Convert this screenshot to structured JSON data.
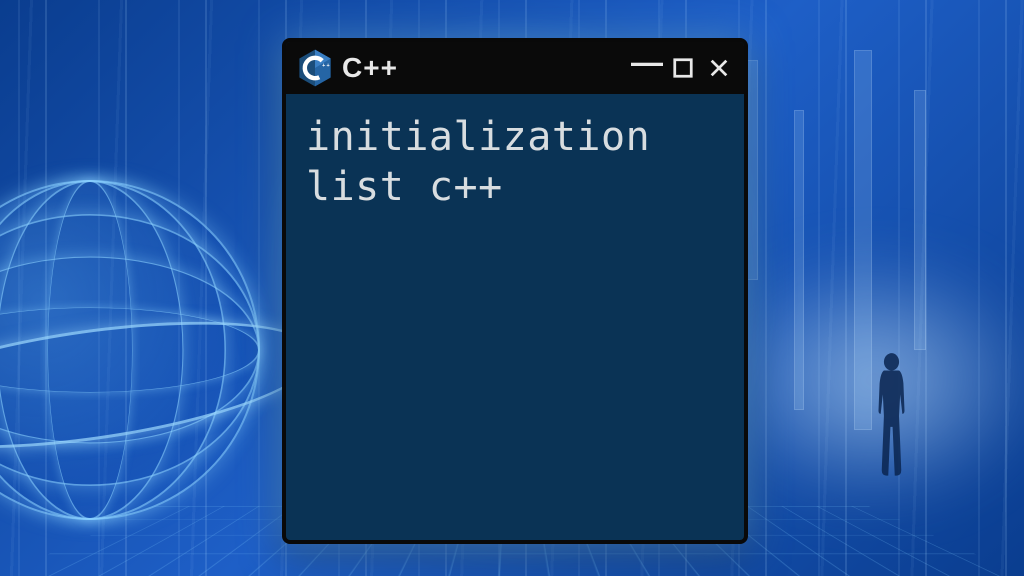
{
  "window": {
    "title": "C++",
    "logo_letter": "C",
    "logo_plus": "++"
  },
  "terminal": {
    "content": "initialization list c++"
  },
  "controls": {
    "minimize": "−",
    "maximize": "□",
    "close": "✕"
  }
}
